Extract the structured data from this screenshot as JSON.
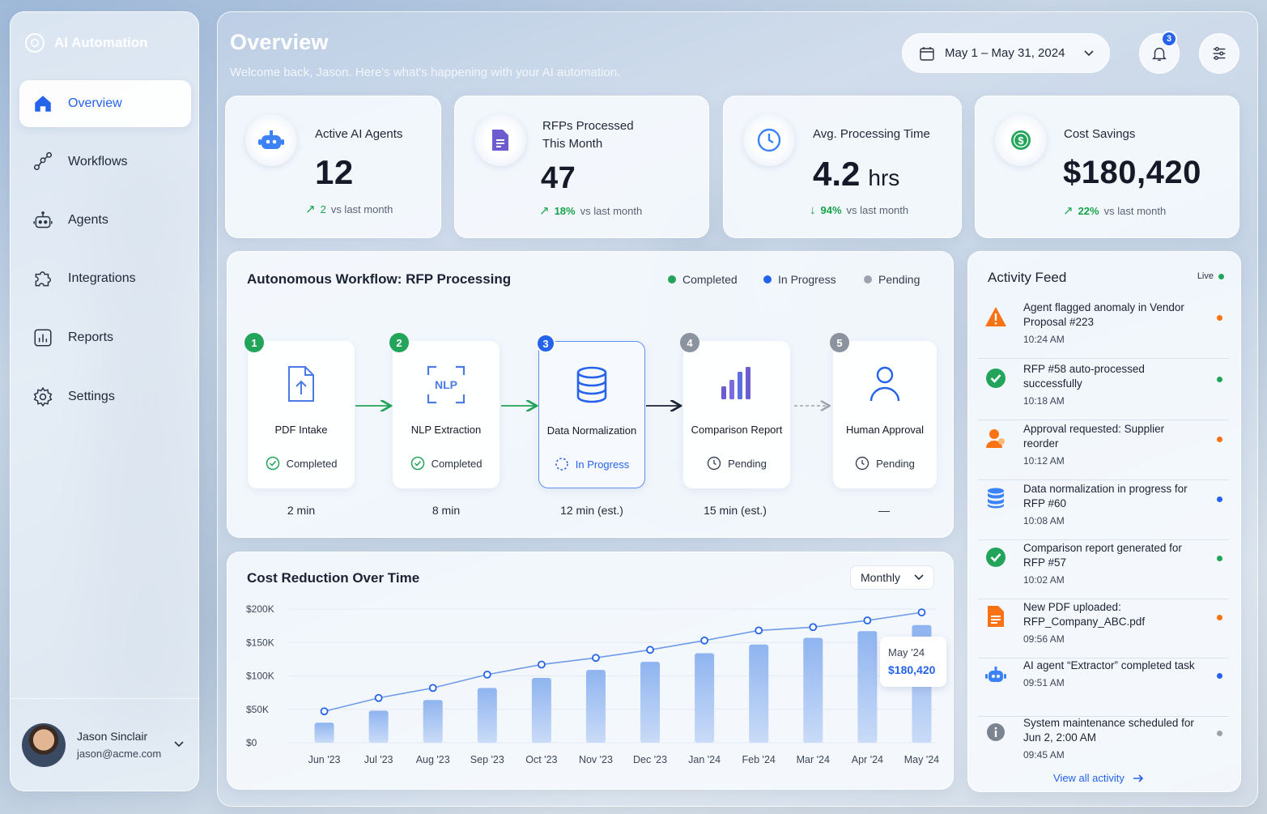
{
  "app": {
    "name": "AI Automation"
  },
  "sidebar": {
    "items": [
      {
        "label": "Overview",
        "icon": "home-icon",
        "active": true
      },
      {
        "label": "Workflows",
        "icon": "workflow-icon"
      },
      {
        "label": "Agents",
        "icon": "robot-icon"
      },
      {
        "label": "Integrations",
        "icon": "puzzle-icon"
      },
      {
        "label": "Reports",
        "icon": "bar-chart-icon"
      },
      {
        "label": "Settings",
        "icon": "gear-icon"
      }
    ],
    "user": {
      "name": "Jason Sinclair",
      "email": "jason@acme.com"
    }
  },
  "header": {
    "title": "Overview",
    "welcome": "Welcome back, Jason. Here's what's happening with your AI automation.",
    "date_range": "May 1 – May 31, 2024",
    "notification_count": "3"
  },
  "kpis": [
    {
      "label": "Active AI Agents",
      "value": "12",
      "unit": "",
      "pct": "",
      "change": "2",
      "suffix": "vs last month",
      "icon": "robot-icon",
      "color": "#3b82f6",
      "trend": "up"
    },
    {
      "label": "RFPs Processed This Month",
      "value": "47",
      "unit": "",
      "change": "18%",
      "suffix": "vs last month",
      "icon": "document-icon",
      "color": "#6d5bd0",
      "trend": "up"
    },
    {
      "label": "Avg. Processing Time",
      "value": "4.2",
      "unit": "hrs",
      "change": "94%",
      "suffix": "vs last month",
      "icon": "clock-icon",
      "color": "#3b82f6",
      "trend": "down"
    },
    {
      "label": "Cost Savings",
      "value": "$180,420",
      "unit": "",
      "change": "22%",
      "suffix": "vs last month",
      "icon": "dollar-icon",
      "color": "#16a34a",
      "trend": "up"
    }
  ],
  "workflow": {
    "title": "Autonomous Workflow: RFP Processing",
    "legend": [
      {
        "label": "Completed",
        "color": "#22a55a"
      },
      {
        "label": "In Progress",
        "color": "#2563eb"
      },
      {
        "label": "Pending",
        "color": "#9aa3ae"
      }
    ],
    "steps": [
      {
        "num": "1",
        "name": "PDF Intake",
        "status": "Completed",
        "duration": "2 min",
        "state": "completed"
      },
      {
        "num": "2",
        "name": "NLP Extraction",
        "status": "Completed",
        "duration": "8 min",
        "state": "completed"
      },
      {
        "num": "3",
        "name": "Data Normalization",
        "status": "In Progress",
        "duration": "12 min (est.)",
        "state": "progress"
      },
      {
        "num": "4",
        "name": "Comparison Report",
        "status": "Pending",
        "duration": "15 min (est.)",
        "state": "pending"
      },
      {
        "num": "5",
        "name": "Human Approval",
        "status": "Pending",
        "duration": "—",
        "state": "pending"
      }
    ],
    "nlp_icon_text": "NLP"
  },
  "cost_chart": {
    "title": "Cost Reduction Over Time",
    "period": "Monthly",
    "tooltip": {
      "label": "May '24",
      "value": "$180,420"
    }
  },
  "chart_data": {
    "type": "bar",
    "title": "Cost Reduction Over Time",
    "categories": [
      "Jun '23",
      "Jul '23",
      "Aug '23",
      "Sep '23",
      "Oct '23",
      "Nov '23",
      "Dec '23",
      "Jan '24",
      "Feb '24",
      "Mar '24",
      "Apr '24",
      "May '24"
    ],
    "series": [
      {
        "type": "bar",
        "values": [
          30000,
          48000,
          64000,
          82000,
          97000,
          109000,
          121000,
          134000,
          147000,
          157000,
          167000,
          176000
        ]
      },
      {
        "type": "line",
        "values": [
          47000,
          67000,
          82000,
          102000,
          117000,
          127000,
          139000,
          153000,
          168000,
          173000,
          183000,
          195000
        ]
      }
    ],
    "yticks": [
      "$0",
      "$50K",
      "$100K",
      "$150K",
      "$200K"
    ],
    "ylim": [
      0,
      200000
    ],
    "grid": true
  },
  "activity": {
    "title": "Activity Feed",
    "live_label": "Live",
    "view_all": "View all activity",
    "items": [
      {
        "text": "Agent flagged anomaly in Vendor Proposal #223",
        "time": "10:24 AM",
        "icon": "warning-icon",
        "dot": "#f97316"
      },
      {
        "text": "RFP #58 auto-processed successfully",
        "time": "10:18 AM",
        "icon": "check-circle-icon",
        "dot": "#22a55a"
      },
      {
        "text": "Approval requested: Supplier reorder",
        "time": "10:12 AM",
        "icon": "user-icon",
        "dot": "#f97316"
      },
      {
        "text": "Data normalization in progress for RFP #60",
        "time": "10:08 AM",
        "icon": "database-icon",
        "dot": "#2563eb"
      },
      {
        "text": "Comparison report generated for RFP #57",
        "time": "10:02 AM",
        "icon": "check-circle-icon",
        "dot": "#22a55a"
      },
      {
        "text": "New PDF uploaded: RFP_Company_ABC.pdf",
        "time": "09:56 AM",
        "icon": "file-icon",
        "dot": "#f97316"
      },
      {
        "text": "AI agent “Extractor” completed task",
        "time": "09:51 AM",
        "icon": "robot-icon",
        "dot": "#2563eb"
      },
      {
        "text": "System maintenance scheduled for Jun 2, 2:00 AM",
        "time": "09:45 AM",
        "icon": "info-icon",
        "dot": "#9aa3ae"
      }
    ]
  }
}
